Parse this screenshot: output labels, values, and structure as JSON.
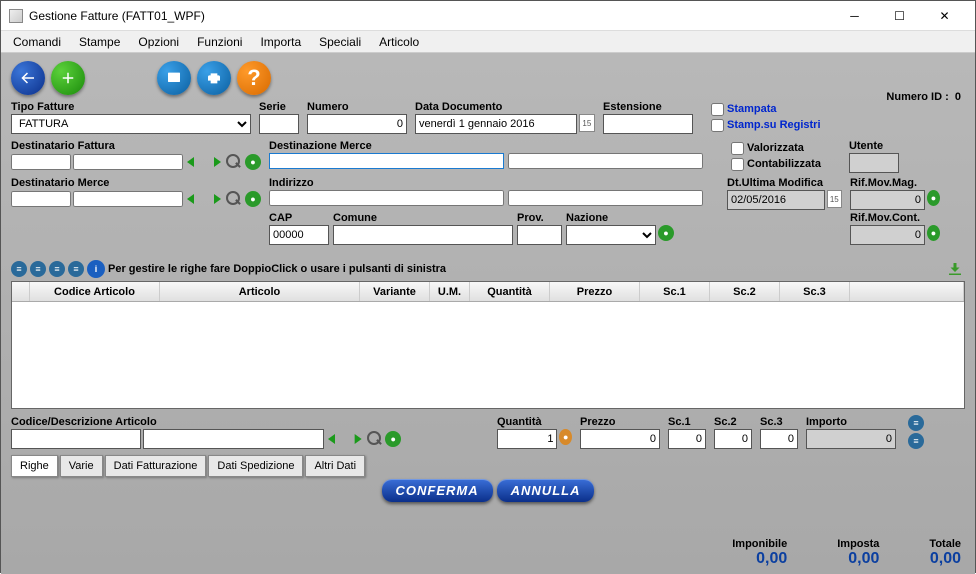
{
  "window": {
    "title": "Gestione Fatture (FATT01_WPF)"
  },
  "menu": [
    "Comandi",
    "Stampe",
    "Opzioni",
    "Funzioni",
    "Importa",
    "Speciali",
    "Articolo"
  ],
  "numero_id": {
    "label": "Numero ID :",
    "value": "0"
  },
  "header": {
    "tipo_fatture": {
      "label": "Tipo Fatture",
      "value": "FATTURA"
    },
    "serie": {
      "label": "Serie",
      "value": ""
    },
    "numero": {
      "label": "Numero",
      "value": "0"
    },
    "data_doc": {
      "label": "Data Documento",
      "value": "venerdì 1 gennaio 2016"
    },
    "estensione": {
      "label": "Estensione",
      "value": ""
    },
    "stampata": "Stampata",
    "stamp_reg": "Stamp.su Registri"
  },
  "dest": {
    "fattura_label": "Destinatario Fattura",
    "merce_label": "Destinatario Merce",
    "destinazione_label": "Destinazione Merce",
    "indirizzo_label": "Indirizzo",
    "cap_label": "CAP",
    "cap_value": "00000",
    "comune_label": "Comune",
    "prov_label": "Prov.",
    "nazione_label": "Nazione",
    "valorizzata": "Valorizzata",
    "contabilizzata": "Contabilizzata",
    "utente": "Utente",
    "ultima_mod": "Dt.Ultima Modifica",
    "ultima_mod_val": "02/05/2016",
    "rif_mag": "Rif.Mov.Mag.",
    "rif_mag_val": "0",
    "rif_cont": "Rif.Mov.Cont.",
    "rif_cont_val": "0"
  },
  "grid": {
    "hint": "Per gestire le righe fare DoppioClick o usare i pulsanti di sinistra",
    "cols": [
      "Codice Articolo",
      "Articolo",
      "Variante",
      "U.M.",
      "Quantità",
      "Prezzo",
      "Sc.1",
      "Sc.2",
      "Sc.3"
    ]
  },
  "entry": {
    "codice_label": "Codice/Descrizione Articolo",
    "quantita_label": "Quantità",
    "quantita_val": "1",
    "prezzo_label": "Prezzo",
    "prezzo_val": "0",
    "sc1_label": "Sc.1",
    "sc1_val": "0",
    "sc2_label": "Sc.2",
    "sc2_val": "0",
    "sc3_label": "Sc.3",
    "sc3_val": "0",
    "importo_label": "Importo",
    "importo_val": "0"
  },
  "tabs": [
    "Righe",
    "Varie",
    "Dati Fatturazione",
    "Dati Spedizione",
    "Altri Dati"
  ],
  "buttons": {
    "confirm": "CONFERMA",
    "cancel": "ANNULLA"
  },
  "totals": {
    "imponibile_label": "Imponibile",
    "imponibile_val": "0,00",
    "imposta_label": "Imposta",
    "imposta_val": "0,00",
    "totale_label": "Totale",
    "totale_val": "0,00"
  }
}
